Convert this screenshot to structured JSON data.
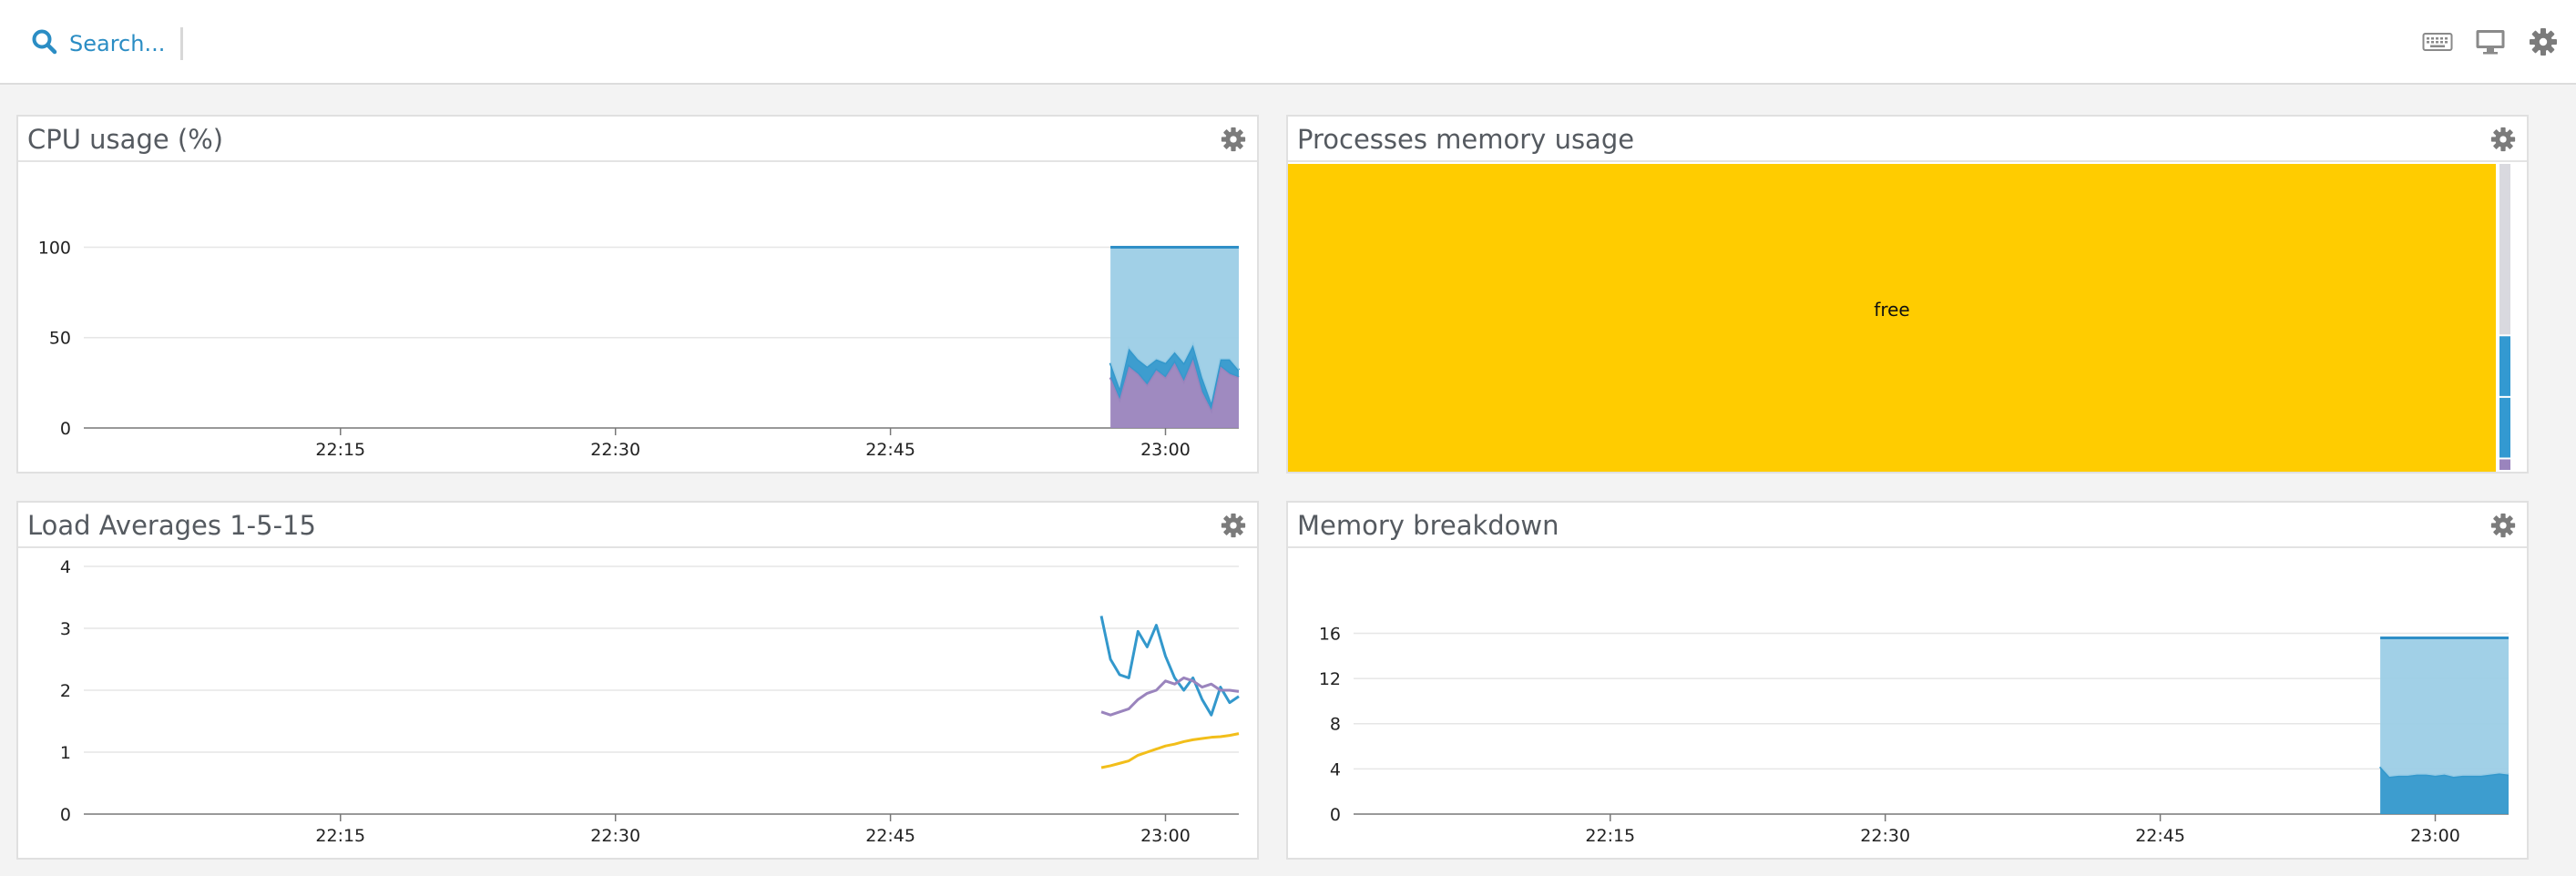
{
  "search": {
    "label": "Search..."
  },
  "topbar_icons": [
    "keyboard-icon",
    "monitor-icon",
    "settings-gear-icon"
  ],
  "colors": {
    "accent": "#2b8dc4",
    "series_blue_light": "#9ccde6",
    "series_blue": "#3398cc",
    "series_purple": "#9a84bd",
    "series_yellow": "#f2be1a",
    "treemap_free": "#ffcc00",
    "treemap_gray": "#d9d9df",
    "treemap_blue": "#3399d1"
  },
  "widgets": {
    "cpu": {
      "title": "CPU usage (%)"
    },
    "proc": {
      "title": "Processes memory usage"
    },
    "load": {
      "title": "Load Averages 1-5-15"
    },
    "mem": {
      "title": "Memory breakdown"
    }
  },
  "chart_data": [
    {
      "id": "cpu",
      "type": "area",
      "title": "CPU usage (%)",
      "x_ticks": [
        "22:15",
        "22:30",
        "22:45",
        "23:00"
      ],
      "y_ticks": [
        0,
        50,
        100
      ],
      "ylim": [
        0,
        100
      ],
      "xlim": [
        "22:01",
        "23:04"
      ],
      "stacked": true,
      "grid": true,
      "x": [
        "22:57",
        "22:57.5",
        "22:58",
        "22:58.5",
        "22:59",
        "22:59.5",
        "23:00",
        "23:00.5",
        "23:01",
        "23:01.5",
        "23:02",
        "23:02.5",
        "23:03",
        "23:03.5",
        "23:04"
      ],
      "series": [
        {
          "color": "#9a84bd",
          "values": [
            28,
            16,
            34,
            30,
            24,
            32,
            28,
            36,
            26,
            38,
            20,
            10,
            34,
            30,
            28
          ]
        },
        {
          "color": "#3398cc",
          "values": [
            8,
            6,
            10,
            8,
            10,
            6,
            8,
            6,
            10,
            8,
            8,
            4,
            4,
            8,
            4
          ]
        },
        {
          "color": "#9ccde6",
          "values": [
            64,
            78,
            56,
            62,
            66,
            62,
            64,
            58,
            64,
            54,
            72,
            86,
            62,
            62,
            68
          ]
        }
      ]
    },
    {
      "id": "proc",
      "type": "treemap",
      "title": "Processes memory usage",
      "items": [
        {
          "label": "free",
          "color": "#ffcc00",
          "value": 98.0
        },
        {
          "label": "",
          "color": "#d9d9df",
          "value": 0.7
        },
        {
          "label": "",
          "color": "#3399d1",
          "value": 0.25
        },
        {
          "label": "",
          "color": "#3399d1",
          "value": 0.25
        },
        {
          "label": "",
          "color": "#9a84bd",
          "value": 0.05
        }
      ]
    },
    {
      "id": "load",
      "type": "line",
      "title": "Load Averages 1-5-15",
      "x_ticks": [
        "22:15",
        "22:30",
        "22:45",
        "23:00"
      ],
      "y_ticks": [
        0,
        1,
        2,
        3,
        4
      ],
      "ylim": [
        0,
        4
      ],
      "xlim": [
        "22:01",
        "23:04"
      ],
      "grid": true,
      "series": [
        {
          "color": "#3398cc",
          "x": [
            "22:56.5",
            "22:57",
            "22:57.5",
            "22:58",
            "22:58.5",
            "22:59",
            "22:59.5",
            "23:00",
            "23:00.5",
            "23:01",
            "23:01.5",
            "23:02",
            "23:02.5",
            "23:03",
            "23:03.5",
            "23:04"
          ],
          "values": [
            3.2,
            2.5,
            2.25,
            2.2,
            2.95,
            2.7,
            3.05,
            2.55,
            2.2,
            2.0,
            2.2,
            1.85,
            1.6,
            2.05,
            1.8,
            1.9
          ]
        },
        {
          "color": "#9a84bd",
          "x": [
            "22:56.5",
            "22:57",
            "22:57.5",
            "22:58",
            "22:58.5",
            "22:59",
            "22:59.5",
            "23:00",
            "23:00.5",
            "23:01",
            "23:01.5",
            "23:02",
            "23:02.5",
            "23:03",
            "23:03.5",
            "23:04"
          ],
          "values": [
            1.65,
            1.6,
            1.65,
            1.7,
            1.85,
            1.95,
            2.0,
            2.15,
            2.1,
            2.2,
            2.15,
            2.05,
            2.1,
            2.0,
            2.0,
            1.98
          ]
        },
        {
          "color": "#f2be1a",
          "x": [
            "22:56.5",
            "22:57",
            "22:57.5",
            "22:58",
            "22:58.5",
            "22:59",
            "22:59.5",
            "23:00",
            "23:00.5",
            "23:01",
            "23:01.5",
            "23:02",
            "23:02.5",
            "23:03",
            "23:03.5",
            "23:04"
          ],
          "values": [
            0.75,
            0.78,
            0.82,
            0.86,
            0.95,
            1.0,
            1.05,
            1.1,
            1.13,
            1.17,
            1.2,
            1.22,
            1.24,
            1.25,
            1.27,
            1.3
          ]
        }
      ]
    },
    {
      "id": "mem",
      "type": "area",
      "title": "Memory breakdown",
      "x_ticks": [
        "22:15",
        "22:30",
        "22:45",
        "23:00"
      ],
      "y_ticks": [
        0,
        4,
        8,
        12,
        16
      ],
      "ylim": [
        0,
        16
      ],
      "xlim": [
        "22:01",
        "23:04"
      ],
      "stacked": true,
      "grid": true,
      "x": [
        "22:57",
        "22:57.5",
        "22:58",
        "22:58.5",
        "22:59",
        "22:59.5",
        "23:00",
        "23:00.5",
        "23:01",
        "23:01.5",
        "23:02",
        "23:02.5",
        "23:03",
        "23:03.5",
        "23:04"
      ],
      "series": [
        {
          "color": "#3398cc",
          "values": [
            4.2,
            3.3,
            3.4,
            3.4,
            3.5,
            3.5,
            3.4,
            3.5,
            3.3,
            3.4,
            3.4,
            3.4,
            3.5,
            3.6,
            3.5
          ]
        },
        {
          "color": "#9ccde6",
          "values": [
            11.4,
            12.3,
            12.2,
            12.2,
            12.1,
            12.1,
            12.2,
            12.1,
            12.3,
            12.2,
            12.2,
            12.2,
            12.1,
            12.0,
            12.1
          ]
        }
      ]
    }
  ]
}
